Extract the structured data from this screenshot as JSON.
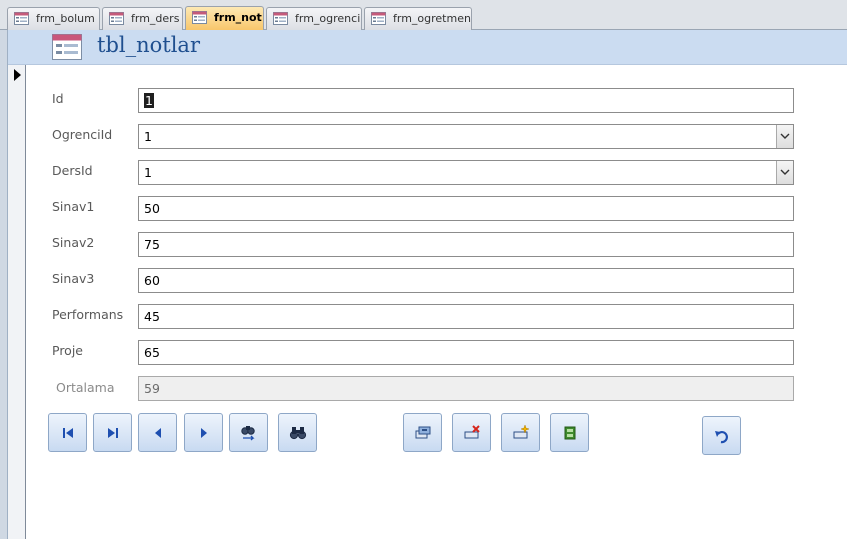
{
  "tabs": [
    {
      "label": "frm_bolum",
      "active": false
    },
    {
      "label": "frm_ders",
      "active": false
    },
    {
      "label": "frm_not",
      "active": true
    },
    {
      "label": "frm_ogrenci",
      "active": false
    },
    {
      "label": "frm_ogretmen",
      "active": false
    }
  ],
  "header": {
    "title": "tbl_notlar"
  },
  "fields": {
    "id": {
      "label": "Id",
      "value": "1"
    },
    "ogrenciid": {
      "label": "OgrenciId",
      "value": "1"
    },
    "dersid": {
      "label": "DersId",
      "value": "1"
    },
    "sinav1": {
      "label": "Sinav1",
      "value": "50"
    },
    "sinav2": {
      "label": "Sinav2",
      "value": "75"
    },
    "sinav3": {
      "label": "Sinav3",
      "value": "60"
    },
    "performans": {
      "label": "Performans",
      "value": "45"
    },
    "proje": {
      "label": "Proje",
      "value": "65"
    },
    "ortalama": {
      "label": "Ortalama",
      "value": "59"
    }
  },
  "buttons": {
    "first": "first-record-icon",
    "last": "last-record-icon",
    "previous": "previous-record-icon",
    "next": "next-record-icon",
    "replace": "find-replace-icon",
    "find": "find-binoculars-icon",
    "save": "save-record-icon",
    "delete": "delete-record-icon",
    "add": "add-record-icon",
    "close": "close-form-icon",
    "undo": "undo-icon"
  },
  "colors": {
    "accent": "#1f4f8f",
    "header_bg": "#cbdcf1",
    "active_tab": "#f8c66b"
  }
}
